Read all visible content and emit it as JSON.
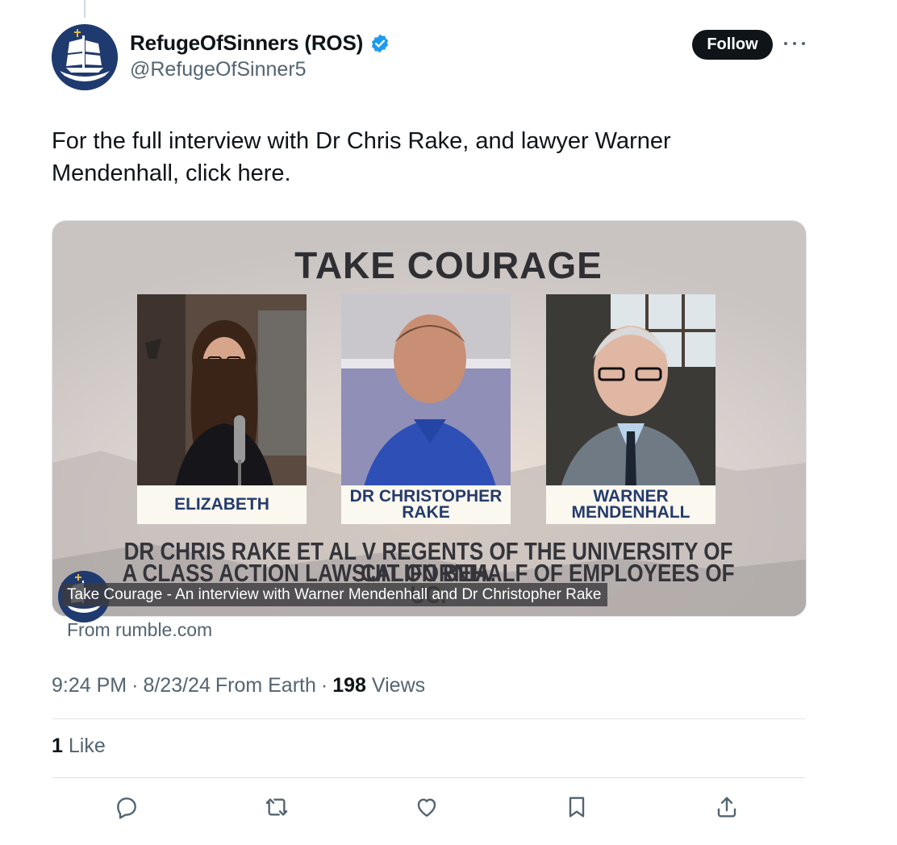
{
  "author": {
    "display_name": "RefugeOfSinners (ROS)",
    "handle": "@RefugeOfSinner5",
    "verified_icon": "verified-badge-icon",
    "brand_color": "#1d9bf0"
  },
  "follow_label": "Follow",
  "tweet_text": "For the full interview with Dr Chris Rake, and lawyer Warner Mendenhall, click here.",
  "card": {
    "title": "TAKE COURAGE",
    "panels": [
      {
        "label": "ELIZABETH"
      },
      {
        "label_line1": "DR CHRISTOPHER",
        "label_line2": "RAKE"
      },
      {
        "label_line1": "WARNER",
        "label_line2": "MENDENHALL"
      }
    ],
    "headline_line1": "DR CHRIS RAKE ET AL V REGENTS OF THE UNIVERSITY OF CALIFORNIA.",
    "headline_line2": "A CLASS ACTION LAWSUIT ON BEHALF OF EMPLOYEES OF UC.",
    "video_title": "Take Courage - An interview with Warner Mendenhall and Dr Christopher Rake",
    "source": "From rumble.com"
  },
  "meta": {
    "time": "9:24 PM",
    "date": "8/23/24",
    "location": "From Earth",
    "views_count": "198",
    "views_label": "Views",
    "separator": "·"
  },
  "likes": {
    "count": "1",
    "label": "Like"
  },
  "actions": [
    "reply-icon",
    "retweet-icon",
    "like-icon",
    "bookmark-icon",
    "share-icon"
  ],
  "colors": {
    "text_secondary": "#536471",
    "follow_bg": "#0f1419",
    "label_text": "#253b6e"
  }
}
